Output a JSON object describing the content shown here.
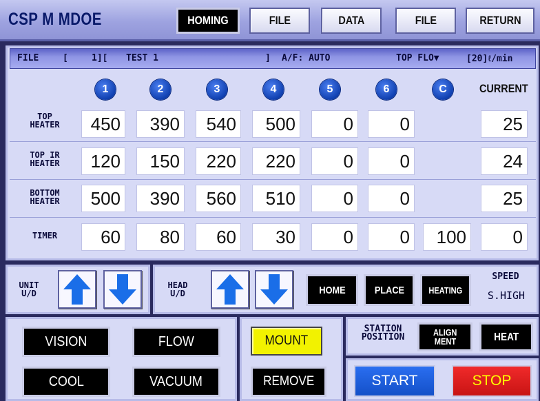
{
  "header": {
    "title": "CSP M MDOE",
    "buttons": [
      "HOMING",
      "FILE",
      "DATA",
      "FILE",
      "RETURN"
    ]
  },
  "file_bar": {
    "file_label": "FILE",
    "file_open_bracket": "[",
    "file_number": "1][",
    "file_name": "TEST 1",
    "file_close_bracket": "]",
    "af": "A/F: AUTO",
    "top_flow_label": "TOP FLO▼",
    "top_flow_value": "[20]ℓ/min"
  },
  "table": {
    "columns": [
      "1",
      "2",
      "3",
      "4",
      "5",
      "6",
      "C"
    ],
    "current_label": "CURRENT",
    "rows": [
      {
        "label_line1": "TOP",
        "label_line2": "HEATER",
        "values": [
          "450",
          "390",
          "540",
          "500",
          "0",
          "0",
          "",
          "25"
        ]
      },
      {
        "label_line1": "TOP IR",
        "label_line2": "HEATER",
        "values": [
          "120",
          "150",
          "220",
          "220",
          "0",
          "0",
          "",
          "24"
        ]
      },
      {
        "label_line1": "BOTTOM",
        "label_line2": "HEATER",
        "values": [
          "500",
          "390",
          "560",
          "510",
          "0",
          "0",
          "",
          "25"
        ]
      },
      {
        "label_line1": "TIMER",
        "label_line2": "",
        "values": [
          "60",
          "80",
          "60",
          "30",
          "0",
          "0",
          "100",
          "0"
        ]
      }
    ]
  },
  "controls": {
    "unit_label_1": "UNIT",
    "unit_label_2": "U/D",
    "head_label_1": "HEAD",
    "head_label_2": "U/D",
    "home": "HOME",
    "place": "PLACE",
    "heating": "HEATING",
    "speed_label": "SPEED",
    "speed_value": "S.HIGH"
  },
  "bottom": {
    "vision": "VISION",
    "flow": "FLOW",
    "cool": "COOL",
    "vacuum": "VACUUM",
    "mount": "MOUNT",
    "remove": "REMOVE",
    "station_label_1": "STATION",
    "station_label_2": "POSITION",
    "align_1": "ALIGN",
    "align_2": "MENT",
    "heat": "HEAT",
    "start": "START",
    "stop": "STOP"
  },
  "colors": {
    "title_text": "#0a1a6a",
    "mount_bg": "#f2f200",
    "start_bg": "#1a5ee0",
    "stop_bg": "#e01a1a",
    "stop_text": "#ffff00",
    "arrow_blue": "#1a6ee8"
  }
}
